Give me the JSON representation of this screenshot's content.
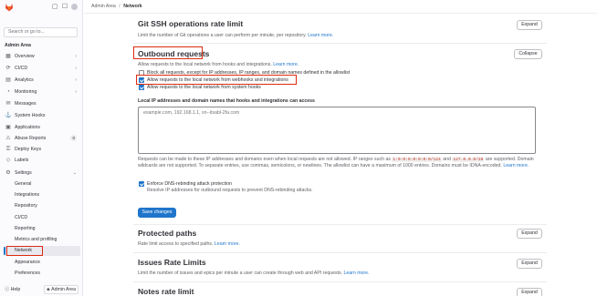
{
  "header": {
    "breadcrumb": [
      "Admin Area",
      "Network"
    ]
  },
  "sidebar": {
    "search_placeholder": "Search or go to...",
    "area_title": "Admin Area",
    "items": [
      {
        "label": "Overview",
        "icon": "overview-icon",
        "glyph": "▦"
      },
      {
        "label": "CI/CD",
        "icon": "rocket-icon",
        "glyph": "⟳"
      },
      {
        "label": "Analytics",
        "icon": "chart-icon",
        "glyph": "▤"
      },
      {
        "label": "Monitoring",
        "icon": "monitor-icon",
        "glyph": "◔"
      },
      {
        "label": "Messages",
        "icon": "message-icon",
        "glyph": "✉"
      },
      {
        "label": "System Hooks",
        "icon": "hook-icon",
        "glyph": "⚓"
      },
      {
        "label": "Applications",
        "icon": "apps-icon",
        "glyph": "▣"
      },
      {
        "label": "Abuse Reports",
        "icon": "warning-icon",
        "glyph": "⚠"
      },
      {
        "label": "Deploy Keys",
        "icon": "key-icon",
        "glyph": "⚿"
      },
      {
        "label": "Labels",
        "icon": "label-icon",
        "glyph": "◇"
      },
      {
        "label": "Settings",
        "icon": "gear-icon",
        "glyph": "⚙"
      }
    ],
    "abuse_badge": "0",
    "settings_sub": [
      "General",
      "Integrations",
      "Repository",
      "CI/CD",
      "Reporting",
      "Metrics and profiling",
      "Network",
      "Appearance",
      "Preferences"
    ],
    "help_label": "Help",
    "admin_area_button": "Admin Area"
  },
  "sections": {
    "git_ssh": {
      "title": "Git SSH operations rate limit",
      "desc": "Limit the number of Git operations a user can perform per minute, per repository.",
      "learn_more": "Learn more.",
      "button": "Expand"
    },
    "outbound": {
      "title": "Outbound requests",
      "desc": "Allow requests to the local network from hooks and integrations.",
      "learn_more": "Learn more.",
      "button": "Collapse",
      "checkboxes": [
        {
          "label": "Block all requests, except for IP addresses, IP ranges, and domain names defined in the allowlist",
          "checked": false
        },
        {
          "label": "Allow requests to the local network from webhooks and integrations",
          "checked": true
        },
        {
          "label": "Allow requests to the local network from system hooks",
          "checked": true
        }
      ],
      "allowlist_label": "Local IP addresses and domain names that hooks and integrations can access",
      "allowlist_placeholder": "example.com, 192.168.1.1, xn--itsabl-2fa.com",
      "help_1": "Requests can be made to these IP addresses and domains even when local requests are not allowed. IP ranges such as",
      "help_code_1": "1:0:0:0:0:0:0:0/124",
      "help_and": "and",
      "help_code_2": "127.0.0.0/28",
      "help_2": "are supported. Domain wildcards are not supported. To separate entries, use commas, semicolons, or newlines. The allowlist can have a maximum of 1000 entries. Domains must be IDNA-encoded.",
      "learn_more_2": "Learn more.",
      "dns_label": "Enforce DNS-rebinding attack protection",
      "dns_checked": true,
      "dns_help": "Resolve IP addresses for outbound requests to prevent DNS-rebinding attacks.",
      "save": "Save changes"
    },
    "protected": {
      "title": "Protected paths",
      "desc": "Rate limit access to specified paths.",
      "learn_more": "Learn more.",
      "button": "Expand"
    },
    "issues": {
      "title": "Issues Rate Limits",
      "desc": "Limit the number of issues and epics per minute a user can create through web and API requests.",
      "learn_more": "Learn more.",
      "button": "Expand"
    },
    "notes": {
      "title": "Notes rate limit",
      "button": "Expand"
    }
  },
  "colors": {
    "accent": "#1f75cb",
    "highlight": "#dd2b0e"
  }
}
